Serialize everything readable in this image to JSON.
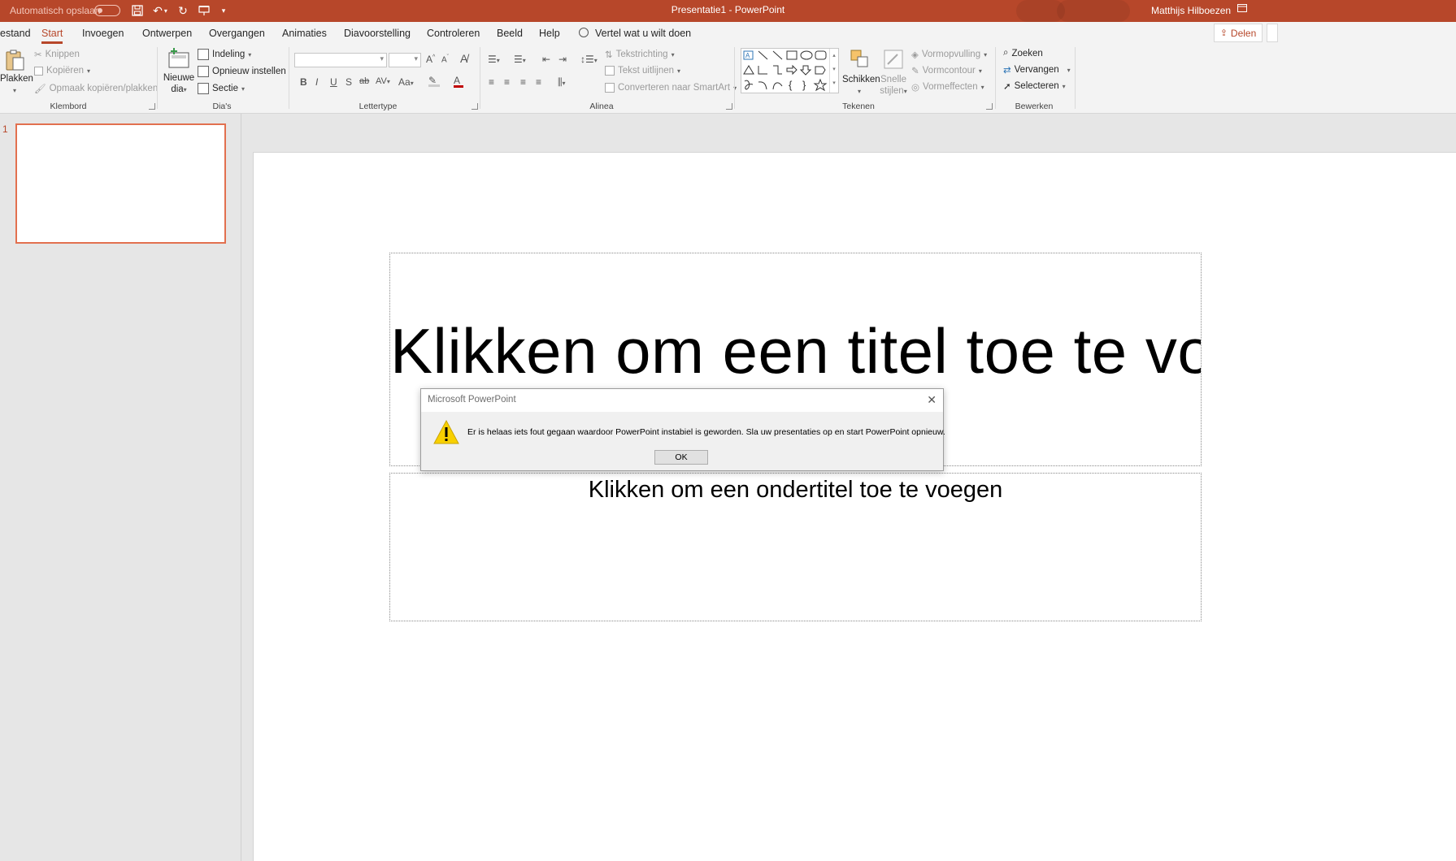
{
  "titlebar": {
    "autosave_label": "Automatisch opslaan",
    "title": "Presentatie1  -  PowerPoint",
    "user": "Matthijs Hilboezen",
    "brand_color": "#b7472a"
  },
  "tabs": [
    {
      "label": "estand"
    },
    {
      "label": "Start"
    },
    {
      "label": "Invoegen"
    },
    {
      "label": "Ontwerpen"
    },
    {
      "label": "Overgangen"
    },
    {
      "label": "Animaties"
    },
    {
      "label": "Diavoorstelling"
    },
    {
      "label": "Controleren"
    },
    {
      "label": "Beeld"
    },
    {
      "label": "Help"
    }
  ],
  "tellme": "Vertel wat u wilt doen",
  "share": "Delen",
  "ribbon": {
    "klembord": {
      "paste": "Plakken",
      "cut": "Knippen",
      "copy": "Kopiëren",
      "format_painter": "Opmaak kopiëren/plakken",
      "label": "Klembord"
    },
    "dias": {
      "new_slide_line1": "Nieuwe",
      "new_slide_line2": "dia",
      "layout": "Indeling",
      "reset": "Opnieuw instellen",
      "section": "Sectie",
      "label": "Dia's"
    },
    "lettertype": {
      "bold": "B",
      "italic": "I",
      "underline": "U",
      "shadow": "S",
      "strike": "ab",
      "spacing": "AV",
      "case": "Aa",
      "grow": "A",
      "shrink": "A",
      "label": "Lettertype"
    },
    "alinea": {
      "text_direction": "Tekstrichting",
      "align_text": "Tekst uitlijnen",
      "smartart": "Converteren naar SmartArt",
      "label": "Alinea"
    },
    "tekenen": {
      "arrange": "Schikken",
      "quick_styles_line1": "Snelle",
      "quick_styles_line2": "stijlen",
      "fill": "Vormopvulling",
      "outline": "Vormcontour",
      "effects": "Vormeffecten",
      "label": "Tekenen"
    },
    "bewerken": {
      "find": "Zoeken",
      "replace": "Vervangen",
      "select": "Selecteren",
      "label": "Bewerken"
    }
  },
  "thumbnails": [
    {
      "number": "1"
    }
  ],
  "slide": {
    "title_placeholder": "Klikken om een titel toe te voegen",
    "subtitle_placeholder": "Klikken om een ondertitel toe te voegen"
  },
  "dialog": {
    "title": "Microsoft PowerPoint",
    "message": "Er is helaas iets fout gegaan waardoor PowerPoint instabiel is geworden. Sla uw presentaties op en start PowerPoint opnieuw.",
    "ok": "OK",
    "icon": "warning-icon"
  }
}
